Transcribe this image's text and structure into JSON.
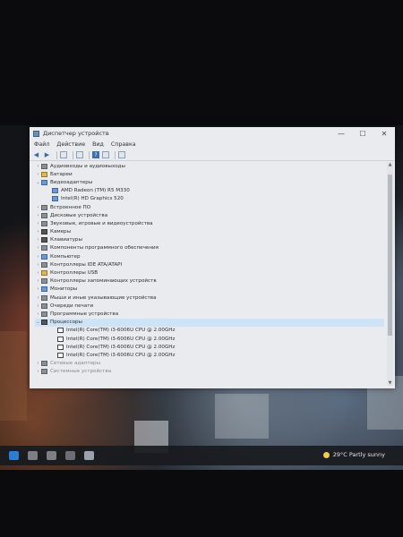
{
  "window": {
    "title": "Диспетчер устройств",
    "controls": {
      "minimize": "—",
      "maximize": "☐",
      "close": "✕"
    }
  },
  "menu": {
    "file": "Файл",
    "action": "Действие",
    "view": "Вид",
    "help": "Справка"
  },
  "tree": [
    {
      "label": "Аудиовходы и аудиовыходы",
      "level": 0,
      "expanded": false,
      "icon": "audio-icon"
    },
    {
      "label": "Батареи",
      "level": 0,
      "expanded": false,
      "icon": "battery-icon"
    },
    {
      "label": "Видеоадаптеры",
      "level": 0,
      "expanded": true,
      "icon": "display-adapter-icon"
    },
    {
      "label": "AMD Radeon (TM) R5 M330",
      "level": 1,
      "icon": "gpu-icon"
    },
    {
      "label": "Intel(R) HD Graphics 520",
      "level": 1,
      "icon": "gpu-icon"
    },
    {
      "label": "Встроенное ПО",
      "level": 0,
      "expanded": false,
      "icon": "firmware-icon"
    },
    {
      "label": "Дисковые устройства",
      "level": 0,
      "expanded": false,
      "icon": "disk-icon"
    },
    {
      "label": "Звуковые, игровые и видеоустройства",
      "level": 0,
      "expanded": false,
      "icon": "sound-icon"
    },
    {
      "label": "Камеры",
      "level": 0,
      "expanded": false,
      "icon": "camera-icon"
    },
    {
      "label": "Клавиатуры",
      "level": 0,
      "expanded": false,
      "icon": "keyboard-icon"
    },
    {
      "label": "Компоненты программного обеспечения",
      "level": 0,
      "expanded": false,
      "icon": "software-icon"
    },
    {
      "label": "Компьютер",
      "level": 0,
      "expanded": false,
      "icon": "computer-icon"
    },
    {
      "label": "Контроллеры IDE ATA/ATAPI",
      "level": 0,
      "expanded": false,
      "icon": "ide-icon"
    },
    {
      "label": "Контроллеры USB",
      "level": 0,
      "expanded": false,
      "icon": "usb-icon"
    },
    {
      "label": "Контроллеры запоминающих устройств",
      "level": 0,
      "expanded": false,
      "icon": "storage-icon"
    },
    {
      "label": "Мониторы",
      "level": 0,
      "expanded": false,
      "icon": "monitor-icon"
    },
    {
      "label": "Мыши и иные указывающие устройства",
      "level": 0,
      "expanded": false,
      "icon": "mouse-icon"
    },
    {
      "label": "Очереди печати",
      "level": 0,
      "expanded": false,
      "icon": "printer-icon"
    },
    {
      "label": "Программные устройства",
      "level": 0,
      "expanded": false,
      "icon": "software-device-icon"
    },
    {
      "label": "Процессоры",
      "level": 0,
      "expanded": true,
      "icon": "processor-icon",
      "selected": true
    },
    {
      "label": "Intel(R) Core(TM) i3-6006U CPU @ 2.00GHz",
      "level": 2,
      "icon": "cpu-icon"
    },
    {
      "label": "Intel(R) Core(TM) i3-6006U CPU @ 2.00GHz",
      "level": 2,
      "icon": "cpu-icon"
    },
    {
      "label": "Intel(R) Core(TM) i3-6006U CPU @ 2.00GHz",
      "level": 2,
      "icon": "cpu-icon"
    },
    {
      "label": "Intel(R) Core(TM) i3-6006U CPU @ 2.00GHz",
      "level": 2,
      "icon": "cpu-icon"
    },
    {
      "label": "Сетевые адаптеры",
      "level": 0,
      "expanded": false,
      "icon": "network-icon",
      "faded": true
    },
    {
      "label": "Системные устройства",
      "level": 0,
      "expanded": false,
      "icon": "system-icon",
      "faded": true
    }
  ],
  "taskbar": {
    "weather_temp": "29°C",
    "weather_text": "Partly sunny"
  }
}
